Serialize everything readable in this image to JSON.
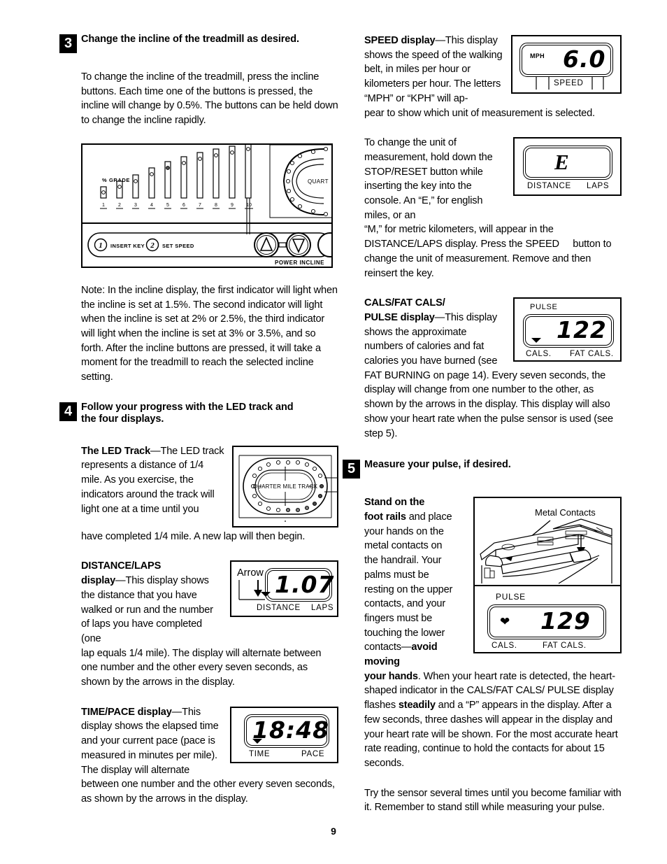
{
  "page": {
    "number": "9"
  },
  "steps": {
    "three": {
      "num": "3",
      "title": "Change the incline of the treadmill as desired.",
      "para1": "To change the incline of the treadmill, press the incline buttons. Each time one of the buttons is pressed, the incline will change by 0.5%. The buttons can be held down to change the incline rapidly.",
      "note": "Note: In the incline display, the first indicator will light when the incline is set at 1.5%. The second indicator will light when the incline is set at 2% or 2.5%, the third indicator will light when the incline is set at 3% or 3.5%, and so forth. After the incline buttons are pressed, it will take a moment for the treadmill to reach the selected incline setting."
    },
    "four": {
      "num": "4",
      "title_line1": "Follow your progress with the LED track and",
      "title_line2": "the four displays.",
      "led_track": {
        "heading": "The LED Track",
        "dash": "—",
        "text_wrap": "The LED track represents a distance of 1/4 mile. As you exercise, the indicators around the track will light one at a time until you",
        "text_full": "have completed 1/4 mile. A new lap will then begin.",
        "track_label": "QUARTER MILE TRACK"
      },
      "distance_laps": {
        "heading_line1": "DISTANCE/LAPS",
        "heading_line2": "display",
        "dash": "—",
        "text_wrap": "This display shows the distance that you have walked or run and the number of laps you have completed (one",
        "text_full": "lap equals 1/4 mile). The display will alternate between one number and the other every seven seconds, as shown by the arrows in the display.",
        "arrow_callout": "Arrow",
        "value": "1.07",
        "label_left": "DISTANCE",
        "label_right": "LAPS"
      },
      "time_pace": {
        "heading": "TIME/PACE display",
        "dash": "—",
        "text_wrap": "This display shows the elapsed time and your current pace (pace is measured in minutes per mile). The display will alternate",
        "text_full": "between one number and the other every seven seconds, as shown by the arrows in the display.",
        "value": "18:48",
        "label_left": "TIME",
        "label_right": "PACE"
      }
    },
    "five": {
      "num": "5",
      "title": "Measure your pulse, if desired.",
      "bold_lead_line1": "Stand on the",
      "bold_lead_line2": "foot rails",
      "text_wrap": " and place your hands on the metal contacts on the handrail. Your palms must be resting on the upper contacts, and your fingers must be touching the lower contacts—",
      "bold_mid_line1": "avoid moving",
      "bold_mid_line2": "your hands",
      "text_after_1": ". When your heart rate is detected, the heart-shaped indicator in the CALS/FAT CALS/ PULSE display flashes ",
      "bold_steadily": "steadily",
      "text_after_2": " and a “P” appears in the display. After a few seconds, three dashes will appear in the display and your heart rate will be shown. For the most accurate heart rate reading, continue to hold the contacts for about 15 seconds.",
      "para_last": "Try the sensor several times until you become familiar with it. Remember to stand still while measuring your pulse.",
      "illustration_label": "Metal Contacts",
      "pulse_display": {
        "top_label": "PULSE",
        "value": "129",
        "label_left": "CALS.",
        "label_right": "FAT CALS."
      }
    }
  },
  "right_column": {
    "speed": {
      "heading": "SPEED display",
      "dash": "—",
      "text_wrap": "This display shows the speed of the walking belt, in miles per hour or kilometers per hour. The letters “MPH” or “KPH” will ap-",
      "text_full": "pear to show which unit of measurement is selected.",
      "unit": "MPH",
      "value": "6.0",
      "label": "SPEED"
    },
    "unit_change": {
      "text_wrap": "To change the unit of measurement, hold down the STOP/RESET button while inserting the key into the console. An “E,” for english miles, or an",
      "text_full": "“M,” for metric kilometers, will appear in the DISTANCE/LAPS display. Press the SPEED     button to change the unit of measurement. Remove and then reinsert the key.",
      "value": "E",
      "label_left": "DISTANCE",
      "label_right": "LAPS"
    },
    "cals": {
      "heading_line1": "CALS/FAT CALS/",
      "heading_line2": "PULSE display",
      "dash": "—",
      "text_wrap": "This display shows the approximate numbers of calories and fat calories you have burned (see",
      "text_full": "FAT BURNING on page 14). Every seven seconds, the display will change from one number to the other, as shown by the arrows in the display. This display will also show your heart rate when the pulse sensor is used (see step 5).",
      "top_label": "PULSE",
      "value": "122",
      "label_left": "CALS.",
      "label_right": "FAT CALS."
    }
  },
  "console_diagram": {
    "grade_label": "% GRADE",
    "bar_numbers": [
      "1",
      "2",
      "3",
      "4",
      "5",
      "6",
      "7",
      "8",
      "9",
      "10"
    ],
    "insert_key_num": "1",
    "insert_key_label": "INSERT KEY",
    "set_speed_num": "2",
    "set_speed_label": "SET SPEED",
    "power_incline_label": "POWER INCLINE",
    "track_label": "QUART"
  },
  "colors": {
    "ink": "#000000",
    "paper": "#ffffff"
  }
}
